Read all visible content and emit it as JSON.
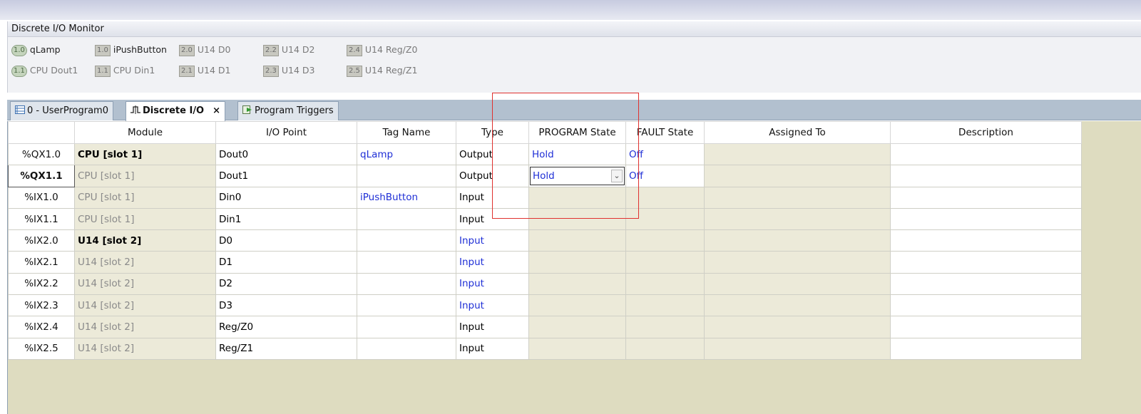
{
  "monitor": {
    "title": "Discrete I/O Monitor",
    "row1": [
      {
        "badge": "1.0",
        "label": "qLamp",
        "round": true,
        "dim": false
      },
      {
        "badge": "1.0",
        "label": "iPushButton",
        "round": false,
        "dim": false
      },
      {
        "badge": "2.0",
        "label": "U14 D0",
        "round": false,
        "dim": true
      },
      {
        "badge": "2.2",
        "label": "U14 D2",
        "round": false,
        "dim": true
      },
      {
        "badge": "2.4",
        "label": "U14 Reg/Z0",
        "round": false,
        "dim": true
      }
    ],
    "row2": [
      {
        "badge": "1.1",
        "label": "CPU Dout1",
        "round": true,
        "dim": true
      },
      {
        "badge": "1.1",
        "label": "CPU Din1",
        "round": false,
        "dim": true
      },
      {
        "badge": "2.1",
        "label": "U14 D1",
        "round": false,
        "dim": true
      },
      {
        "badge": "2.3",
        "label": "U14 D3",
        "round": false,
        "dim": true
      },
      {
        "badge": "2.5",
        "label": "U14 Reg/Z1",
        "round": false,
        "dim": true
      }
    ]
  },
  "tabs": [
    {
      "label": "0 - UserProgram0",
      "icon": "ladder-program-icon"
    },
    {
      "label": "Discrete I/O",
      "icon": "discrete-io-icon",
      "close": "×"
    },
    {
      "label": "Program Triggers",
      "icon": "program-triggers-icon"
    }
  ],
  "grid": {
    "headers": [
      "",
      "Module",
      "I/O Point",
      "Tag Name",
      "Type",
      "PROGRAM State",
      "FAULT State",
      "Assigned To",
      "Description"
    ],
    "rows": [
      {
        "addr": "%QX1.0",
        "module": "CPU [slot 1]",
        "point": "Dout0",
        "tag": "qLamp",
        "type": "Output",
        "program": "Hold",
        "fault": "Off",
        "assigned": "",
        "desc": ""
      },
      {
        "addr": "%QX1.1",
        "module": "CPU [slot 1]",
        "point": "Dout1",
        "tag": "",
        "type": "Output",
        "program": "Hold",
        "fault": "Off",
        "assigned": "",
        "desc": ""
      },
      {
        "addr": "%IX1.0",
        "module": "CPU [slot 1]",
        "point": "Din0",
        "tag": "iPushButton",
        "type": "Input",
        "program": "",
        "fault": "",
        "assigned": "",
        "desc": ""
      },
      {
        "addr": "%IX1.1",
        "module": "CPU [slot 1]",
        "point": "Din1",
        "tag": "",
        "type": "Input",
        "program": "",
        "fault": "",
        "assigned": "",
        "desc": ""
      },
      {
        "addr": "%IX2.0",
        "module": "U14 [slot 2]",
        "point": "D0",
        "tag": "",
        "type": "Input",
        "program": "",
        "fault": "",
        "assigned": "",
        "desc": ""
      },
      {
        "addr": "%IX2.1",
        "module": "U14 [slot 2]",
        "point": "D1",
        "tag": "",
        "type": "Input",
        "program": "",
        "fault": "",
        "assigned": "",
        "desc": ""
      },
      {
        "addr": "%IX2.2",
        "module": "U14 [slot 2]",
        "point": "D2",
        "tag": "",
        "type": "Input",
        "program": "",
        "fault": "",
        "assigned": "",
        "desc": ""
      },
      {
        "addr": "%IX2.3",
        "module": "U14 [slot 2]",
        "point": "D3",
        "tag": "",
        "type": "Input",
        "program": "",
        "fault": "",
        "assigned": "",
        "desc": ""
      },
      {
        "addr": "%IX2.4",
        "module": "U14 [slot 2]",
        "point": "Reg/Z0",
        "tag": "",
        "type": "Input",
        "program": "",
        "fault": "",
        "assigned": "",
        "desc": ""
      },
      {
        "addr": "%IX2.5",
        "module": "U14 [slot 2]",
        "point": "Reg/Z1",
        "tag": "",
        "type": "Input",
        "program": "",
        "fault": "",
        "assigned": "",
        "desc": ""
      }
    ]
  },
  "colors": {
    "link_blue": "#1f2fd6",
    "highlight_red": "#e0312f",
    "grid_beige": "#ecead9"
  }
}
